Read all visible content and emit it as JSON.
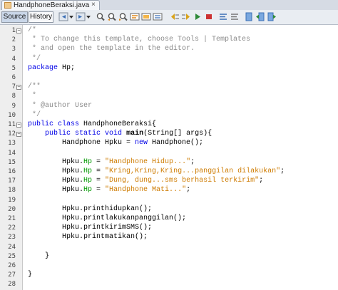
{
  "tab": {
    "file_name": "HandphoneBeraksi.java",
    "close_glyph": "×"
  },
  "toolbar": {
    "source_label": "Source",
    "history_label": "History",
    "icons": [
      "back-icon",
      "dropdown-icon",
      "forward-icon",
      "dropdown-icon",
      "find-icon",
      "find-previous-icon",
      "find-next-icon",
      "find-selection-icon",
      "toggle-highlight-icon",
      "toggle-rectangle-selection-icon",
      "shift-left-icon",
      "shift-right-icon",
      "record-macro-icon",
      "stop-macro-icon",
      "comment-icon",
      "uncomment-icon",
      "toggle-bookmark-icon",
      "previous-bookmark-icon",
      "next-bookmark-icon"
    ]
  },
  "editor": {
    "line_numbers": [
      "1",
      "2",
      "3",
      "4",
      "5",
      "6",
      "7",
      "8",
      "9",
      "10",
      "11",
      "12",
      "13",
      "14",
      "15",
      "16",
      "17",
      "18",
      "19",
      "20",
      "21",
      "22",
      "23",
      "24",
      "25",
      "26",
      "27",
      "28"
    ],
    "lines": [
      [
        [
          "com",
          "/*"
        ]
      ],
      [
        [
          "com",
          " * To change this template, choose Tools | Templates"
        ]
      ],
      [
        [
          "com",
          " * and open the template in the editor."
        ]
      ],
      [
        [
          "com",
          " */"
        ]
      ],
      [
        [
          "kw",
          "package"
        ],
        [
          "txt",
          " Hp;"
        ]
      ],
      [
        [
          "txt",
          ""
        ]
      ],
      [
        [
          "com",
          "/**"
        ]
      ],
      [
        [
          "com",
          " *"
        ]
      ],
      [
        [
          "com",
          " * @author User"
        ]
      ],
      [
        [
          "com",
          " */"
        ]
      ],
      [
        [
          "kw",
          "public class"
        ],
        [
          "txt",
          " HandphoneBeraksi{"
        ]
      ],
      [
        [
          "txt",
          "    "
        ],
        [
          "kw",
          "public static void"
        ],
        [
          "txt",
          " "
        ],
        [
          "b",
          "main"
        ],
        [
          "txt",
          "(String[] args){"
        ]
      ],
      [
        [
          "txt",
          "        Handphone Hpku = "
        ],
        [
          "kw",
          "new"
        ],
        [
          "txt",
          " Handphone();"
        ]
      ],
      [
        [
          "txt",
          ""
        ]
      ],
      [
        [
          "txt",
          "        Hpku."
        ],
        [
          "fld",
          "Hp"
        ],
        [
          "txt",
          " = "
        ],
        [
          "str",
          "\"Handphone Hidup...\""
        ],
        [
          "txt",
          ";"
        ]
      ],
      [
        [
          "txt",
          "        Hpku."
        ],
        [
          "fld",
          "Hp"
        ],
        [
          "txt",
          " = "
        ],
        [
          "str",
          "\"Kring,Kring,Kring...panggilan dilakukan\""
        ],
        [
          "txt",
          ";"
        ]
      ],
      [
        [
          "txt",
          "        Hpku."
        ],
        [
          "fld",
          "Hp"
        ],
        [
          "txt",
          " = "
        ],
        [
          "str",
          "\"Dung, dung...sms berhasil terkirim\""
        ],
        [
          "txt",
          ";"
        ]
      ],
      [
        [
          "txt",
          "        Hpku."
        ],
        [
          "fld",
          "Hp"
        ],
        [
          "txt",
          " = "
        ],
        [
          "str",
          "\"Handphone Mati...\""
        ],
        [
          "txt",
          ";"
        ]
      ],
      [
        [
          "txt",
          ""
        ]
      ],
      [
        [
          "txt",
          "        Hpku.printhidupkan();"
        ]
      ],
      [
        [
          "txt",
          "        Hpku.printlakukanpanggilan();"
        ]
      ],
      [
        [
          "txt",
          "        Hpku.printkirimSMS();"
        ]
      ],
      [
        [
          "txt",
          "        Hpku.printmatikan();"
        ]
      ],
      [
        [
          "txt",
          ""
        ]
      ],
      [
        [
          "txt",
          "    }"
        ]
      ],
      [
        [
          "txt",
          ""
        ]
      ],
      [
        [
          "txt",
          "}"
        ]
      ],
      [
        [
          "txt",
          ""
        ]
      ]
    ],
    "fold_markers": {
      "0": "−",
      "6": "−",
      "10": "−",
      "11": "−"
    },
    "colors": {
      "keyword": "#0000e6",
      "comment": "#8a8a8a",
      "string": "#ce7b00",
      "field": "#009900"
    }
  }
}
